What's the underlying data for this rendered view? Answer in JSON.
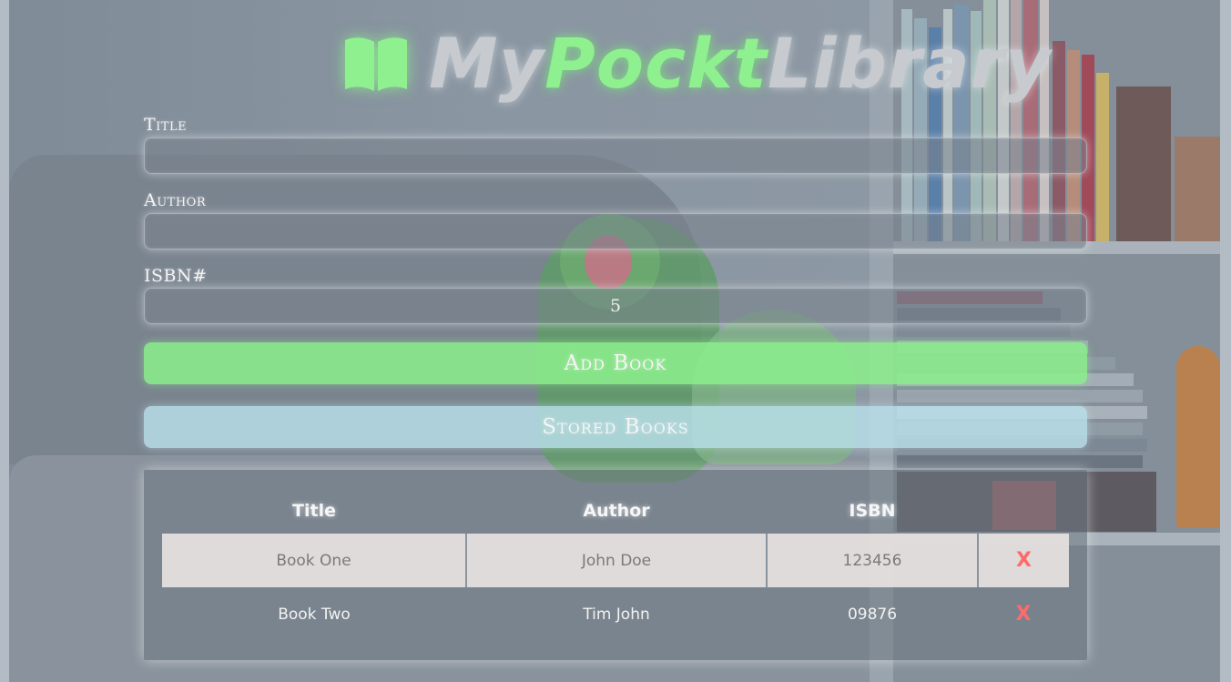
{
  "logo": {
    "part1": "My",
    "part2": "Pockt",
    "part3": "Library",
    "icon": "open-book-icon",
    "accent_color": "#8ef08e"
  },
  "form": {
    "title_label": "Title",
    "title_value": "",
    "author_label": "Author",
    "author_value": "",
    "isbn_label": "ISBN#",
    "isbn_value": "5",
    "add_button": "Add Book",
    "stored_button": "Stored Books"
  },
  "table": {
    "headers": [
      "Title",
      "Author",
      "ISBN"
    ],
    "rows": [
      {
        "title": "Book One",
        "author": "John Doe",
        "isbn": "123456",
        "delete": "X"
      },
      {
        "title": "Book Two",
        "author": "Tim John",
        "isbn": "09876",
        "delete": "X"
      }
    ]
  },
  "colors": {
    "add_button": "#8cf08c",
    "stored_button": "#b9e1eb",
    "delete": "#ff6a6a"
  }
}
